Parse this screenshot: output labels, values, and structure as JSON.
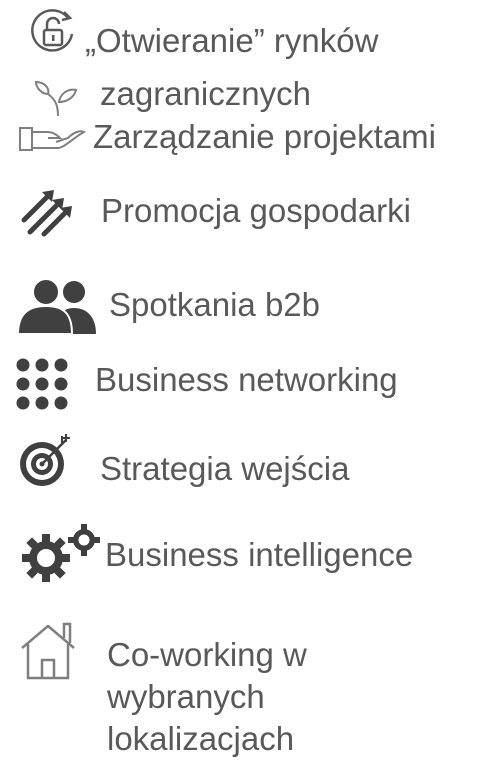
{
  "colors": {
    "text": "#595959",
    "icon_dark": "#404040",
    "icon_outline": "#7f7f7f"
  },
  "items": [
    {
      "label": "„Otwieranie” rynków",
      "icon": "unlock-refresh-icon"
    },
    {
      "label": "zagranicznych",
      "icon": "plant-sprout-icon"
    },
    {
      "label": "Zarządzanie projektami",
      "icon": "hand-holding-icon"
    },
    {
      "label": "Promocja gospodarki",
      "icon": "trending-arrows-icon"
    },
    {
      "label": "Spotkania b2b",
      "icon": "users-icon"
    },
    {
      "label": "Business networking",
      "icon": "dots-grid-icon"
    },
    {
      "label": "Strategia wejścia",
      "icon": "target-icon"
    },
    {
      "label": "Business intelligence",
      "icon": "gears-icon"
    },
    {
      "label": "Co-working w wybranych lokalizacjach",
      "icon": "house-icon"
    }
  ]
}
